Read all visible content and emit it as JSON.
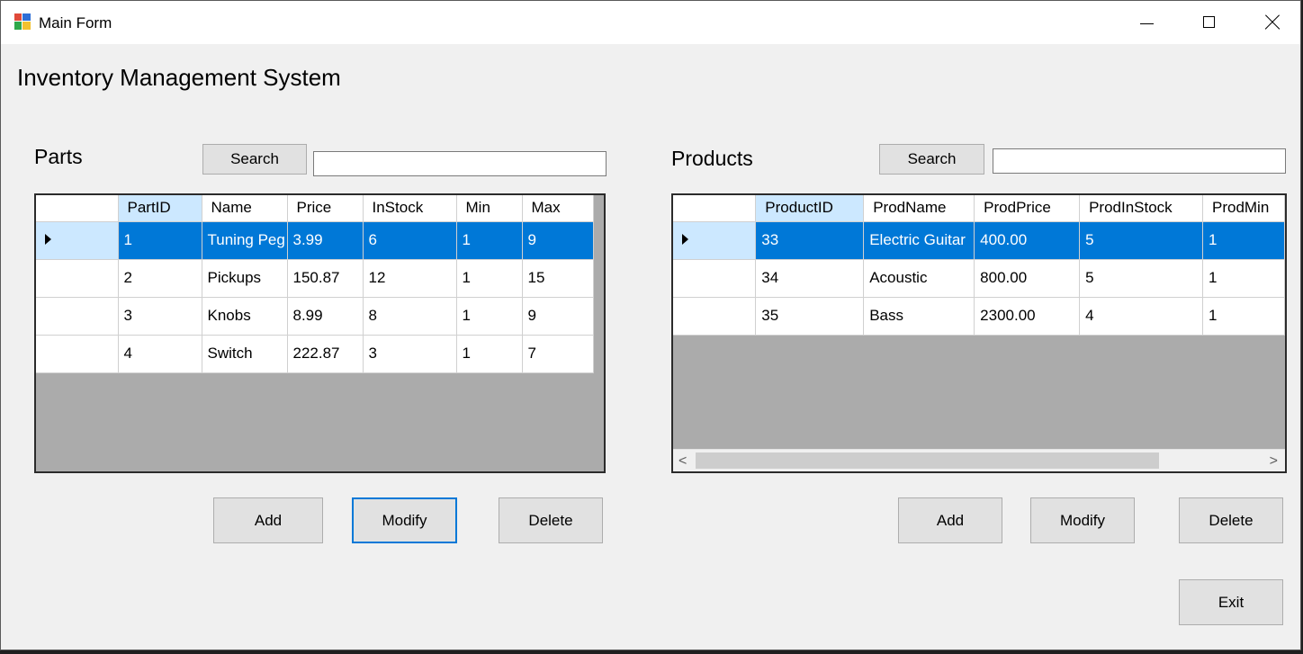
{
  "window": {
    "title": "Main Form"
  },
  "app": {
    "title": "Inventory Management System"
  },
  "parts": {
    "label": "Parts",
    "search_label": "Search",
    "search_value": "",
    "columns": [
      "PartID",
      "Name",
      "Price",
      "InStock",
      "Min",
      "Max"
    ],
    "rows": [
      [
        "1",
        "Tuning Peg",
        "3.99",
        "6",
        "1",
        "9"
      ],
      [
        "2",
        "Pickups",
        "150.87",
        "12",
        "1",
        "15"
      ],
      [
        "3",
        "Knobs",
        "8.99",
        "8",
        "1",
        "9"
      ],
      [
        "4",
        "Switch",
        "222.87",
        "3",
        "1",
        "7"
      ]
    ],
    "selected_row": 0,
    "add_label": "Add",
    "modify_label": "Modify",
    "delete_label": "Delete"
  },
  "products": {
    "label": "Products",
    "search_label": "Search",
    "search_value": "",
    "columns": [
      "ProductID",
      "ProdName",
      "ProdPrice",
      "ProdInStock",
      "ProdMin"
    ],
    "rows": [
      [
        "33",
        "Electric Guitar",
        "400.00",
        "5",
        "1"
      ],
      [
        "34",
        "Acoustic",
        "800.00",
        "5",
        "1"
      ],
      [
        "35",
        "Bass",
        "2300.00",
        "4",
        "1"
      ]
    ],
    "selected_row": 0,
    "add_label": "Add",
    "modify_label": "Modify",
    "delete_label": "Delete"
  },
  "exit_label": "Exit",
  "colors": {
    "selection": "#0078d7",
    "header_selected": "#cce8ff",
    "grid_bg": "#ababab"
  }
}
